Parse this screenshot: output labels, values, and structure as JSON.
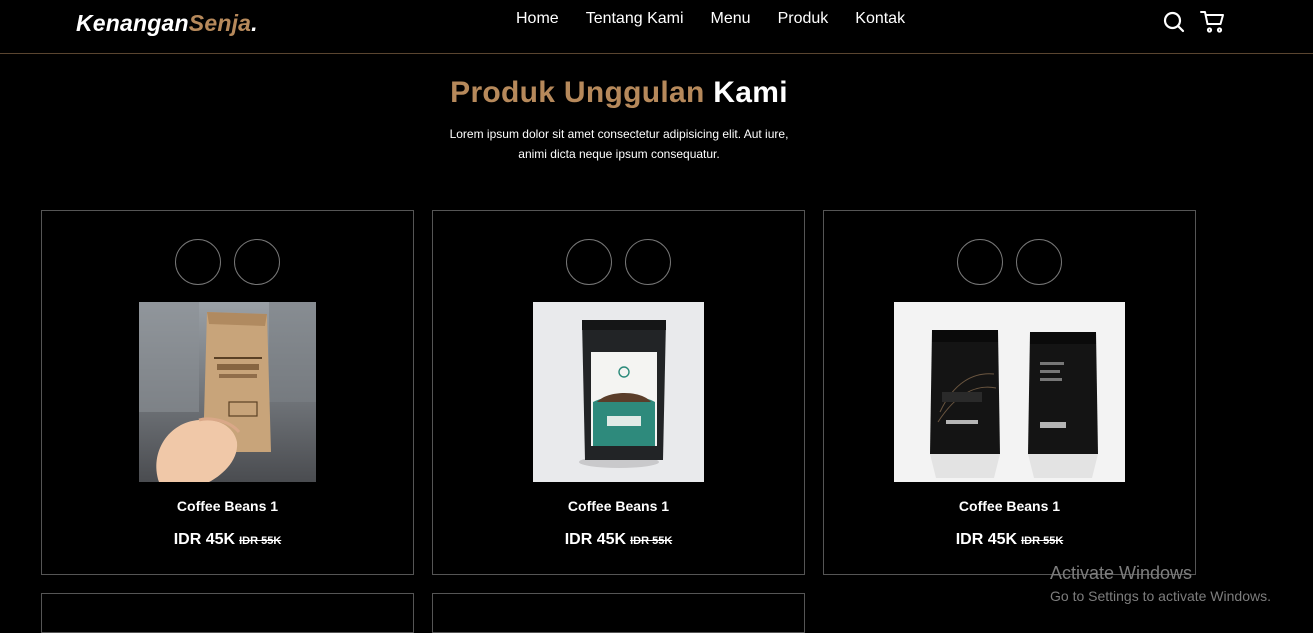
{
  "brand": {
    "name": "Kenangan",
    "accent": "Senja",
    "dot": "."
  },
  "nav": {
    "links": [
      "Home",
      "Tentang Kami",
      "Menu",
      "Produk",
      "Kontak"
    ],
    "icons": [
      "search-icon",
      "shopping-cart-icon"
    ]
  },
  "hero": {
    "title_accent": "Produk Unggulan",
    "title_rest": "Kami",
    "subtitle_line1": "Lorem ipsum dolor sit amet consectetur adipisicing elit. Aut iure,",
    "subtitle_line2": "animi dicta neque ipsum consequatur."
  },
  "products": [
    {
      "name": "Coffee Beans 1",
      "price": "IDR 45K",
      "old_price": "IDR 55K",
      "image": "kraft-coffee-bag-in-hand"
    },
    {
      "name": "Coffee Beans 1",
      "price": "IDR 45K",
      "old_price": "IDR 55K",
      "image": "black-luwak-coffee-pouch"
    },
    {
      "name": "Coffee Beans 1",
      "price": "IDR 45K",
      "old_price": "IDR 55K",
      "image": "kopi-mantir-pouches"
    }
  ],
  "watermark": {
    "line1": "Activate Windows",
    "line2": "Go to Settings to activate Windows."
  },
  "colors": {
    "accent": "#b6895b",
    "background": "#000000",
    "border": "#555555"
  }
}
